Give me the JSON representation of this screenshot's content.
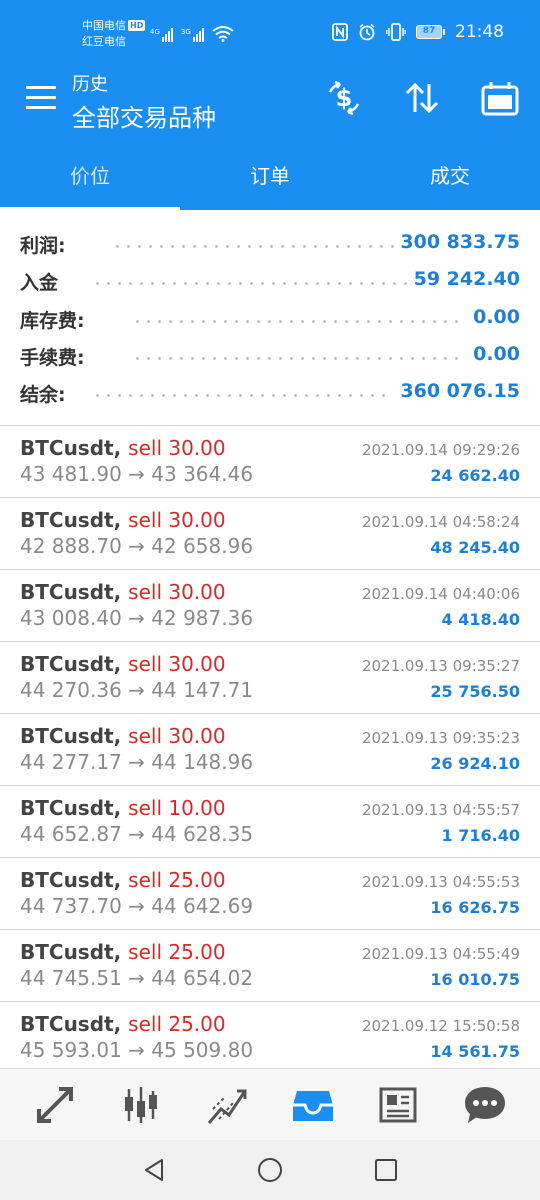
{
  "status_bar": {
    "carrier_1": "中国电信",
    "hd_badge": "HD",
    "carrier_2": "红豆电信",
    "net_1": "4G",
    "net_2": "3G",
    "battery": "87",
    "time": "21:48"
  },
  "app_bar": {
    "subtitle": "历史",
    "title": "全部交易品种"
  },
  "tabs": [
    {
      "label": "价位",
      "active": true
    },
    {
      "label": "订单",
      "active": false
    },
    {
      "label": "成交",
      "active": false
    }
  ],
  "summary": [
    {
      "label": "利润:",
      "value": "300 833.75"
    },
    {
      "label": "入金",
      "value": "59 242.40"
    },
    {
      "label": "库存费:",
      "value": "0.00"
    },
    {
      "label": "手续费:",
      "value": "0.00"
    },
    {
      "label": "结余:",
      "value": "360 076.15"
    }
  ],
  "trades": [
    {
      "symbol": "BTCusdt,",
      "side": "sell 30.00",
      "prices": "43 481.90 → 43 364.46",
      "time": "2021.09.14 09:29:26",
      "profit": "24 662.40"
    },
    {
      "symbol": "BTCusdt,",
      "side": "sell 30.00",
      "prices": "42 888.70 → 42 658.96",
      "time": "2021.09.14 04:58:24",
      "profit": "48 245.40"
    },
    {
      "symbol": "BTCusdt,",
      "side": "sell 30.00",
      "prices": "43 008.40 → 42 987.36",
      "time": "2021.09.14 04:40:06",
      "profit": "4 418.40"
    },
    {
      "symbol": "BTCusdt,",
      "side": "sell 30.00",
      "prices": "44 270.36 → 44 147.71",
      "time": "2021.09.13 09:35:27",
      "profit": "25 756.50"
    },
    {
      "symbol": "BTCusdt,",
      "side": "sell 30.00",
      "prices": "44 277.17 → 44 148.96",
      "time": "2021.09.13 09:35:23",
      "profit": "26 924.10"
    },
    {
      "symbol": "BTCusdt,",
      "side": "sell 10.00",
      "prices": "44 652.87 → 44 628.35",
      "time": "2021.09.13 04:55:57",
      "profit": "1 716.40"
    },
    {
      "symbol": "BTCusdt,",
      "side": "sell 25.00",
      "prices": "44 737.70 → 44 642.69",
      "time": "2021.09.13 04:55:53",
      "profit": "16 626.75"
    },
    {
      "symbol": "BTCusdt,",
      "side": "sell 25.00",
      "prices": "44 745.51 → 44 654.02",
      "time": "2021.09.13 04:55:49",
      "profit": "16 010.75"
    },
    {
      "symbol": "BTCusdt,",
      "side": "sell 25.00",
      "prices": "45 593.01 → 45 509.80",
      "time": "2021.09.12 15:50:58",
      "profit": "14 561.75"
    }
  ],
  "bottom_nav": [
    {
      "icon": "quotes-arrows-icon",
      "active": false
    },
    {
      "icon": "candlestick-chart-icon",
      "active": false
    },
    {
      "icon": "trade-chart-icon",
      "active": false
    },
    {
      "icon": "history-inbox-icon",
      "active": true
    },
    {
      "icon": "news-icon",
      "active": false
    },
    {
      "icon": "chat-icon",
      "active": false
    }
  ],
  "colors": {
    "primary": "#1b8ef2",
    "profit": "#1e7fd8",
    "sell": "#d42a2a",
    "muted": "#8a8a8a",
    "nav_active": "#1b8ef2",
    "nav_inactive": "#555555"
  }
}
